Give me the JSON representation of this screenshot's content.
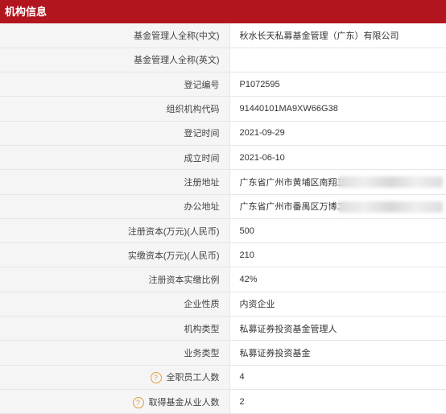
{
  "header": {
    "title": "机构信息"
  },
  "rows": [
    {
      "label": "基金管理人全称(中文)",
      "value": "秋水长天私募基金管理（广东）有限公司"
    },
    {
      "label": "基金管理人全称(英文)",
      "value": ""
    },
    {
      "label": "登记编号",
      "value": "P1072595"
    },
    {
      "label": "组织机构代码",
      "value": "91440101MA9XW66G38"
    },
    {
      "label": "登记时间",
      "value": "2021-09-29"
    },
    {
      "label": "成立时间",
      "value": "2021-06-10"
    },
    {
      "label": "注册地址",
      "value": "广东省广州市黄埔区南翔三"
    },
    {
      "label": "办公地址",
      "value": "广东省广州市番禺区万博二"
    },
    {
      "label": "注册资本(万元)(人民币)",
      "value": "500"
    },
    {
      "label": "实缴资本(万元)(人民币)",
      "value": "210"
    },
    {
      "label": "注册资本实缴比例",
      "value": "42%"
    },
    {
      "label": "企业性质",
      "value": "内资企业"
    },
    {
      "label": "机构类型",
      "value": "私募证券投资基金管理人"
    },
    {
      "label": "业务类型",
      "value": "私募证券投资基金"
    },
    {
      "label": "全职员工人数",
      "value": "4"
    },
    {
      "label": "取得基金从业人数",
      "value": "2"
    }
  ],
  "help_icon": "?",
  "colors": {
    "header_bg": "#b3151f",
    "label_bg": "#f5f5f5",
    "help_icon": "#e0a040"
  }
}
